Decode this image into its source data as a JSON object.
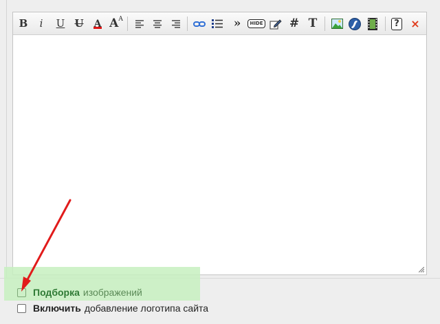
{
  "toolbar": {
    "bold": "B",
    "italic": "i",
    "underline": "U",
    "strike": "U",
    "font_color": "A",
    "font_size": "A",
    "hide": "HIDE",
    "hash": "#",
    "text": "T",
    "quote": "»",
    "help": "?",
    "remove": "×",
    "icons": [
      "bold-icon",
      "italic-icon",
      "underline-icon",
      "strikethrough-icon",
      "font-color-icon",
      "font-size-icon",
      "align-left-icon",
      "align-center-icon",
      "align-right-icon",
      "link-icon",
      "list-icon",
      "quote-icon",
      "hide-icon",
      "edit-icon",
      "hash-icon",
      "text-icon",
      "image-icon",
      "flash-icon",
      "video-icon",
      "help-icon",
      "remove-icon"
    ]
  },
  "editor": {
    "content": ""
  },
  "options": {
    "gallery": {
      "bold": "Подборка",
      "rest": "изображений",
      "checked": false
    },
    "logo": {
      "bold": "Включить",
      "rest": "добавление логотипа сайта",
      "checked": false
    }
  },
  "colors": {
    "highlight": "#c7f0c0",
    "arrow": "#e11b1b",
    "font_color_bar": "#e01515",
    "link_icon": "#2f6fd6",
    "remove_icon": "#e03a1b"
  }
}
